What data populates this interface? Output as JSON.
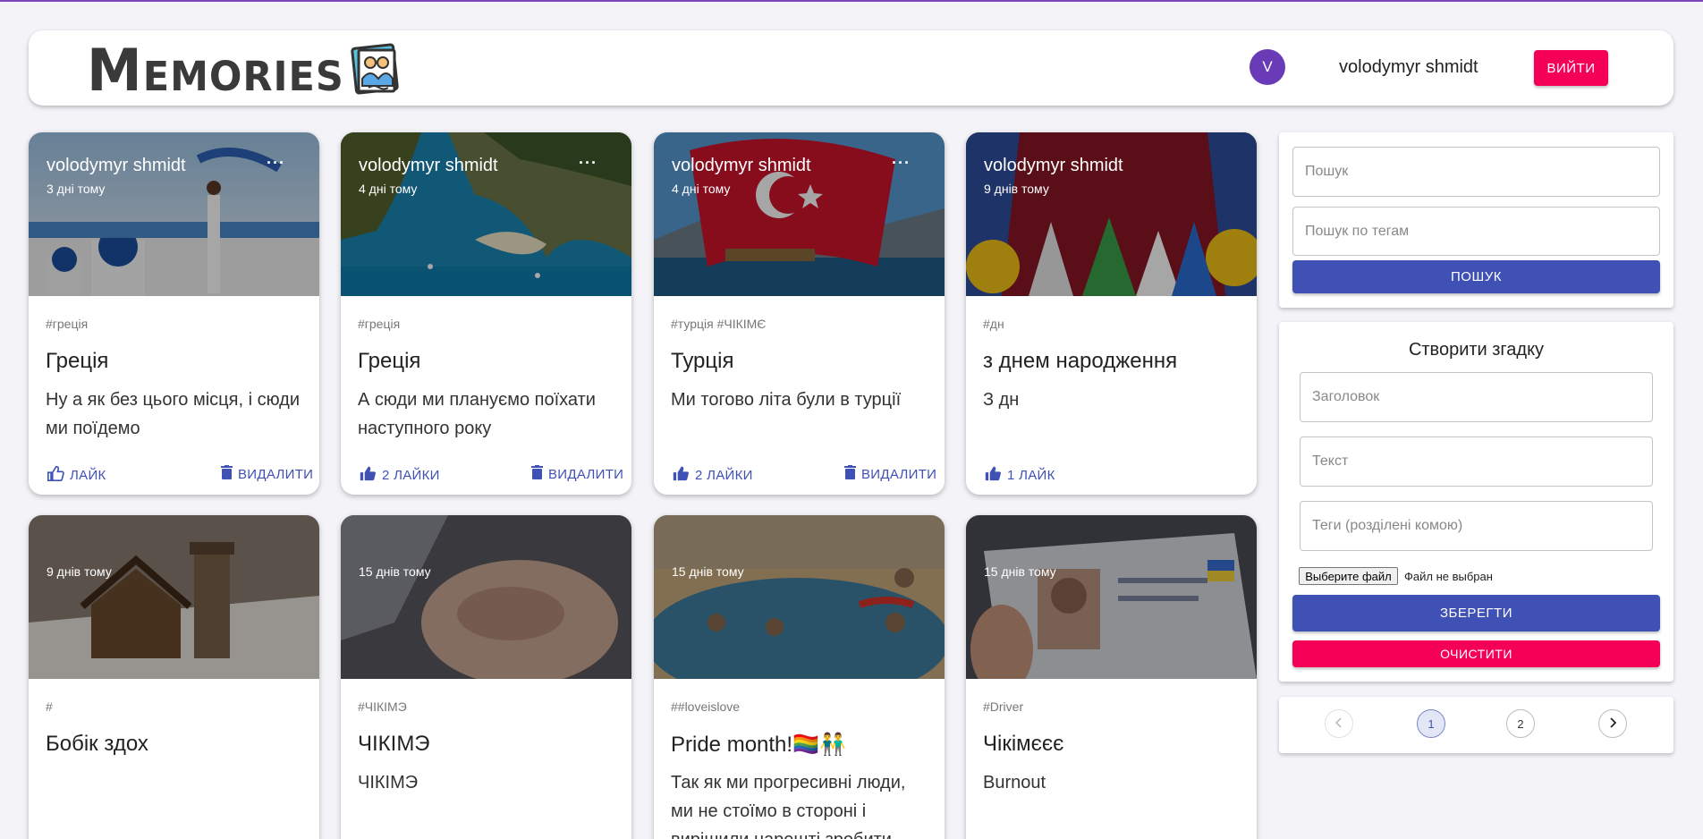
{
  "header": {
    "brand": "Memories",
    "avatar_letter": "V",
    "user_name": "volodymyr shmidt",
    "logout_label": "ВИЙТИ"
  },
  "posts": [
    {
      "author": "volodymyr shmidt",
      "date": "3 дні тому",
      "tags": "#греція",
      "title": "Греція",
      "text": "Ну а як без цього місця, і сюди ми поїдемо",
      "like_label": "ЛАЙК",
      "delete_label": "ВИДАЛИТИ",
      "liked": false
    },
    {
      "author": "volodymyr shmidt",
      "date": "4 дні тому",
      "tags": "#греція",
      "title": "Греція",
      "text": "А сюди ми плануємо поїхати наступного року",
      "like_label": "2 ЛАЙКИ",
      "delete_label": "ВИДАЛИТИ",
      "liked": true
    },
    {
      "author": "volodymyr shmidt",
      "date": "4 дні тому",
      "tags": "#турція #ЧІКІМЄ",
      "title": "Турція",
      "text": "Ми тогово літа були в турції",
      "like_label": "2 ЛАЙКИ",
      "delete_label": "ВИДАЛИТИ",
      "liked": true
    },
    {
      "author": "volodymyr shmidt",
      "date": "9 днів тому",
      "tags": "#дн",
      "title": "з днем народження",
      "text": "З дн",
      "like_label": "1 ЛАЙК",
      "delete_label": "",
      "liked": true
    },
    {
      "author": "",
      "date": "9 днів тому",
      "tags": "#",
      "title": "Бобік здох",
      "text": "",
      "like_label": "",
      "delete_label": "",
      "liked": false
    },
    {
      "author": "",
      "date": "15 днів тому",
      "tags": "#ЧІКІМЭ",
      "title": "ЧІКІМЭ",
      "text": "ЧІКІМЭ",
      "like_label": "",
      "delete_label": "",
      "liked": false
    },
    {
      "author": "",
      "date": "15 днів тому",
      "tags": "##loveislove",
      "title": "Pride month!🏳️‍🌈👬",
      "text": "Так як ми прогресивні люди, ми не стоїмо в стороні і вирішили нарешті зробити",
      "like_label": "",
      "delete_label": "",
      "liked": false
    },
    {
      "author": "",
      "date": "15 днів тому",
      "tags": "#Driver",
      "title": "Чікімєєє",
      "text": "Burnout",
      "like_label": "",
      "delete_label": "",
      "liked": false
    }
  ],
  "search": {
    "query_placeholder": "Пошук",
    "tags_placeholder": "Пошук по тегам",
    "button_label": "ПОШУК"
  },
  "form": {
    "title": "Створити згадку",
    "title_placeholder": "Заголовок",
    "text_placeholder": "Текст",
    "tags_placeholder": "Теги (розділені комою)",
    "file_button": "Выберите файл",
    "file_status": "Файл не выбран",
    "save_label": "ЗБЕРЕГТИ",
    "clear_label": "ОЧИСТИТИ"
  },
  "pagination": {
    "pages": [
      "1",
      "2"
    ],
    "current": "1",
    "prev_icon": "chevron-left-icon",
    "next_icon": "chevron-right-icon"
  },
  "colors": {
    "primary": "#3f51b5",
    "secondary": "#f50057",
    "avatar": "#6a3bb6",
    "background": "#f3f3f8"
  }
}
